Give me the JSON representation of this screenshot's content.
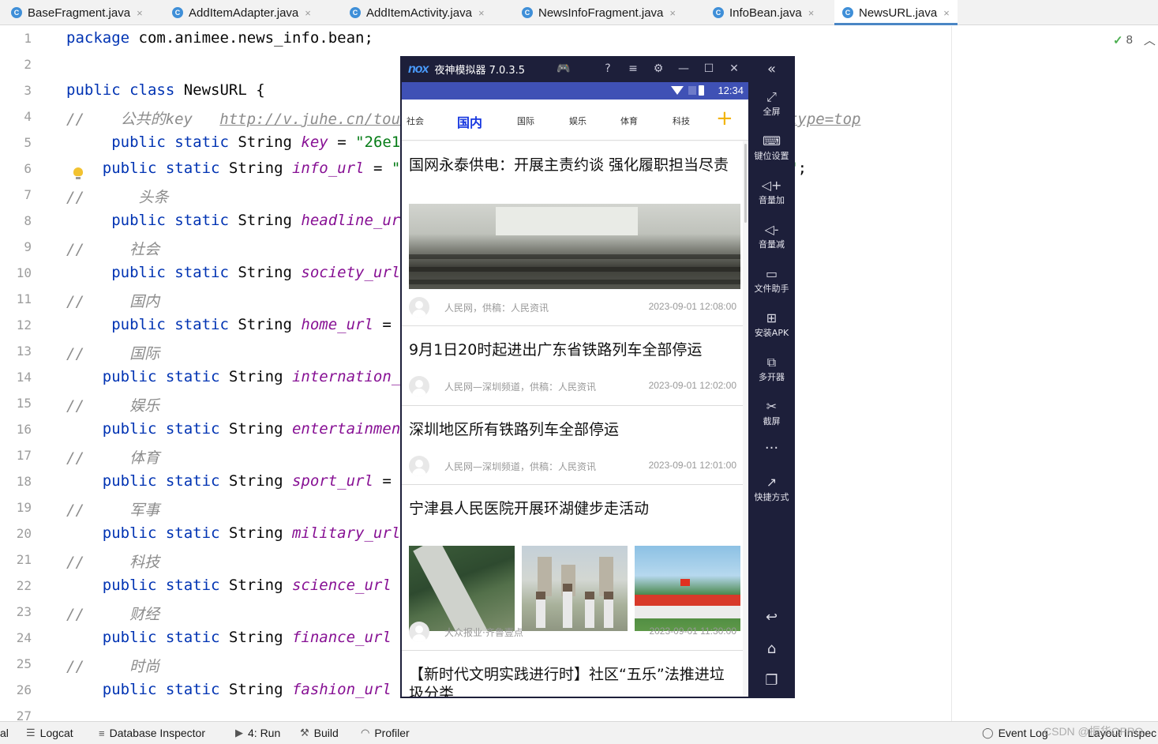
{
  "tabs": [
    {
      "label": "BaseFragment.java",
      "icon": "class-icon",
      "active": false
    },
    {
      "label": "AddItemAdapter.java",
      "icon": "class-icon",
      "active": false
    },
    {
      "label": "AddItemActivity.java",
      "icon": "class-icon",
      "active": false
    },
    {
      "label": "NewsInfoFragment.java",
      "icon": "class-icon",
      "active": false
    },
    {
      "label": "InfoBean.java",
      "icon": "class-icon",
      "active": false
    },
    {
      "label": "NewsURL.java",
      "icon": "class-icon",
      "active": true
    }
  ],
  "tab_icon_glyph": "C",
  "tab_close_glyph": "×",
  "editor": {
    "inspections_count": "8",
    "lines": [
      {
        "n": "1",
        "segs": [
          {
            "t": "package ",
            "c": "kw"
          },
          {
            "t": "com.animee.news_info.bean;",
            "c": ""
          }
        ]
      },
      {
        "n": "2",
        "segs": []
      },
      {
        "n": "3",
        "segs": [
          {
            "t": "public class ",
            "c": "kw"
          },
          {
            "t": "NewsURL {",
            "c": ""
          }
        ]
      },
      {
        "n": "4",
        "segs": [
          {
            "t": "//    公共的key   ",
            "c": "cm"
          },
          {
            "t": "http://v.juhe.cn/tout",
            "c": "url"
          },
          {
            "t": "                                        ",
            "c": ""
          },
          {
            "t": "a&type=top",
            "c": "url"
          }
        ]
      },
      {
        "n": "5",
        "segs": [
          {
            "t": "     public static ",
            "c": "kw"
          },
          {
            "t": "String ",
            "c": ""
          },
          {
            "t": "key",
            "c": "fld"
          },
          {
            "t": " = ",
            "c": ""
          },
          {
            "t": "\"26e18",
            "c": "str"
          }
        ]
      },
      {
        "n": "6",
        "segs": [
          {
            "t": "    public static ",
            "c": "kw"
          },
          {
            "t": "String ",
            "c": ""
          },
          {
            "t": "info_url",
            "c": "fld"
          },
          {
            "t": " = ",
            "c": ""
          },
          {
            "t": "\"h",
            "c": "str"
          },
          {
            "t": "                                       ",
            "c": ""
          },
          {
            "t": "pe=\"",
            "c": "str"
          },
          {
            "t": ";",
            "c": ""
          }
        ]
      },
      {
        "n": "7",
        "segs": [
          {
            "t": "//      头条",
            "c": "cm"
          }
        ]
      },
      {
        "n": "8",
        "segs": [
          {
            "t": "     public static ",
            "c": "kw"
          },
          {
            "t": "String ",
            "c": ""
          },
          {
            "t": "headline_url",
            "c": "fld"
          }
        ]
      },
      {
        "n": "9",
        "segs": [
          {
            "t": "//     社会",
            "c": "cm"
          }
        ]
      },
      {
        "n": "10",
        "segs": [
          {
            "t": "     public static ",
            "c": "kw"
          },
          {
            "t": "String ",
            "c": ""
          },
          {
            "t": "society_url",
            "c": "fld"
          }
        ]
      },
      {
        "n": "11",
        "segs": [
          {
            "t": "//     国内",
            "c": "cm"
          }
        ]
      },
      {
        "n": "12",
        "segs": [
          {
            "t": "     public static ",
            "c": "kw"
          },
          {
            "t": "String ",
            "c": ""
          },
          {
            "t": "home_url",
            "c": "fld"
          },
          {
            "t": " = ",
            "c": ""
          },
          {
            "t": "i",
            "c": "fld"
          }
        ]
      },
      {
        "n": "13",
        "segs": [
          {
            "t": "//     国际",
            "c": "cm"
          }
        ]
      },
      {
        "n": "14",
        "segs": [
          {
            "t": "    public static ",
            "c": "kw"
          },
          {
            "t": "String ",
            "c": ""
          },
          {
            "t": "internation_u",
            "c": "fld"
          }
        ]
      },
      {
        "n": "15",
        "segs": [
          {
            "t": "//     娱乐",
            "c": "cm"
          }
        ]
      },
      {
        "n": "16",
        "segs": [
          {
            "t": "    public static ",
            "c": "kw"
          },
          {
            "t": "String ",
            "c": ""
          },
          {
            "t": "entertainment",
            "c": "fld"
          }
        ]
      },
      {
        "n": "17",
        "segs": [
          {
            "t": "//     体育",
            "c": "cm"
          }
        ]
      },
      {
        "n": "18",
        "segs": [
          {
            "t": "    public static ",
            "c": "kw"
          },
          {
            "t": "String ",
            "c": ""
          },
          {
            "t": "sport_url",
            "c": "fld"
          },
          {
            "t": " = ",
            "c": ""
          },
          {
            "t": "i",
            "c": "fld"
          }
        ]
      },
      {
        "n": "19",
        "segs": [
          {
            "t": "//     军事",
            "c": "cm"
          }
        ]
      },
      {
        "n": "20",
        "segs": [
          {
            "t": "    public static ",
            "c": "kw"
          },
          {
            "t": "String ",
            "c": ""
          },
          {
            "t": "military_url",
            "c": "fld"
          }
        ]
      },
      {
        "n": "21",
        "segs": [
          {
            "t": "//     科技",
            "c": "cm"
          }
        ]
      },
      {
        "n": "22",
        "segs": [
          {
            "t": "    public static ",
            "c": "kw"
          },
          {
            "t": "String ",
            "c": ""
          },
          {
            "t": "science_url",
            "c": "fld"
          },
          {
            "t": " =",
            "c": ""
          }
        ]
      },
      {
        "n": "23",
        "segs": [
          {
            "t": "//     财经",
            "c": "cm"
          }
        ]
      },
      {
        "n": "24",
        "segs": [
          {
            "t": "    public static ",
            "c": "kw"
          },
          {
            "t": "String ",
            "c": ""
          },
          {
            "t": "finance_url",
            "c": "fld"
          },
          {
            "t": " =",
            "c": ""
          }
        ]
      },
      {
        "n": "25",
        "segs": [
          {
            "t": "//     时尚",
            "c": "cm"
          }
        ]
      },
      {
        "n": "26",
        "segs": [
          {
            "t": "    public static ",
            "c": "kw"
          },
          {
            "t": "String ",
            "c": ""
          },
          {
            "t": "fashion_url",
            "c": "fld"
          },
          {
            "t": " =",
            "c": ""
          }
        ]
      },
      {
        "n": "27",
        "segs": []
      }
    ]
  },
  "toolwindows": {
    "left_stub": "al",
    "logcat": "Logcat",
    "database_inspector": "Database Inspector",
    "run": "4: Run",
    "build": "Build",
    "profiler": "Profiler",
    "event_log": "Event Log",
    "layout_inspector": "Layout Inspec"
  },
  "watermark": "CSDN @振华OPPO",
  "emulator": {
    "logo": "nox",
    "title": "夜神模拟器 7.0.3.5",
    "time": "12:34",
    "categories": [
      "社会",
      "国内",
      "国际",
      "娱乐",
      "体育",
      "科技"
    ],
    "selected_category": "国内",
    "add_glyph": "+",
    "news": [
      {
        "title": "国网永泰供电：开展主责约谈 强化履职担当尽责",
        "source": "人民网，供稿：人民资讯",
        "date": "2023-09-01 12:08:00"
      },
      {
        "title": "9月1日20时起进出广东省铁路列车全部停运",
        "source": "人民网—深圳频道，供稿：人民资讯",
        "date": "2023-09-01 12:02:00"
      },
      {
        "title": "深圳地区所有铁路列车全部停运",
        "source": "人民网—深圳频道，供稿：人民资讯",
        "date": "2023-09-01 12:01:00"
      },
      {
        "title": "宁津县人民医院开展环湖健步走活动",
        "source": "大众报业·齐鲁壹点",
        "date": "2023-09-01 11:30:00"
      },
      {
        "title": "【新时代文明实践进行时】社区“五乐”法推进垃圾分类",
        "source": "",
        "date": ""
      }
    ],
    "sidebar": [
      {
        "label": "全屏",
        "icon": "fullscreen-icon"
      },
      {
        "label": "键位设置",
        "icon": "keyboard-icon"
      },
      {
        "label": "音量加",
        "icon": "volume-up-icon"
      },
      {
        "label": "音量减",
        "icon": "volume-down-icon"
      },
      {
        "label": "文件助手",
        "icon": "file-helper-icon"
      },
      {
        "label": "安装APK",
        "icon": "install-apk-icon"
      },
      {
        "label": "多开器",
        "icon": "multi-instance-icon"
      },
      {
        "label": "截屏",
        "icon": "screenshot-icon"
      },
      {
        "label": "快捷方式",
        "icon": "shortcut-icon"
      }
    ]
  }
}
